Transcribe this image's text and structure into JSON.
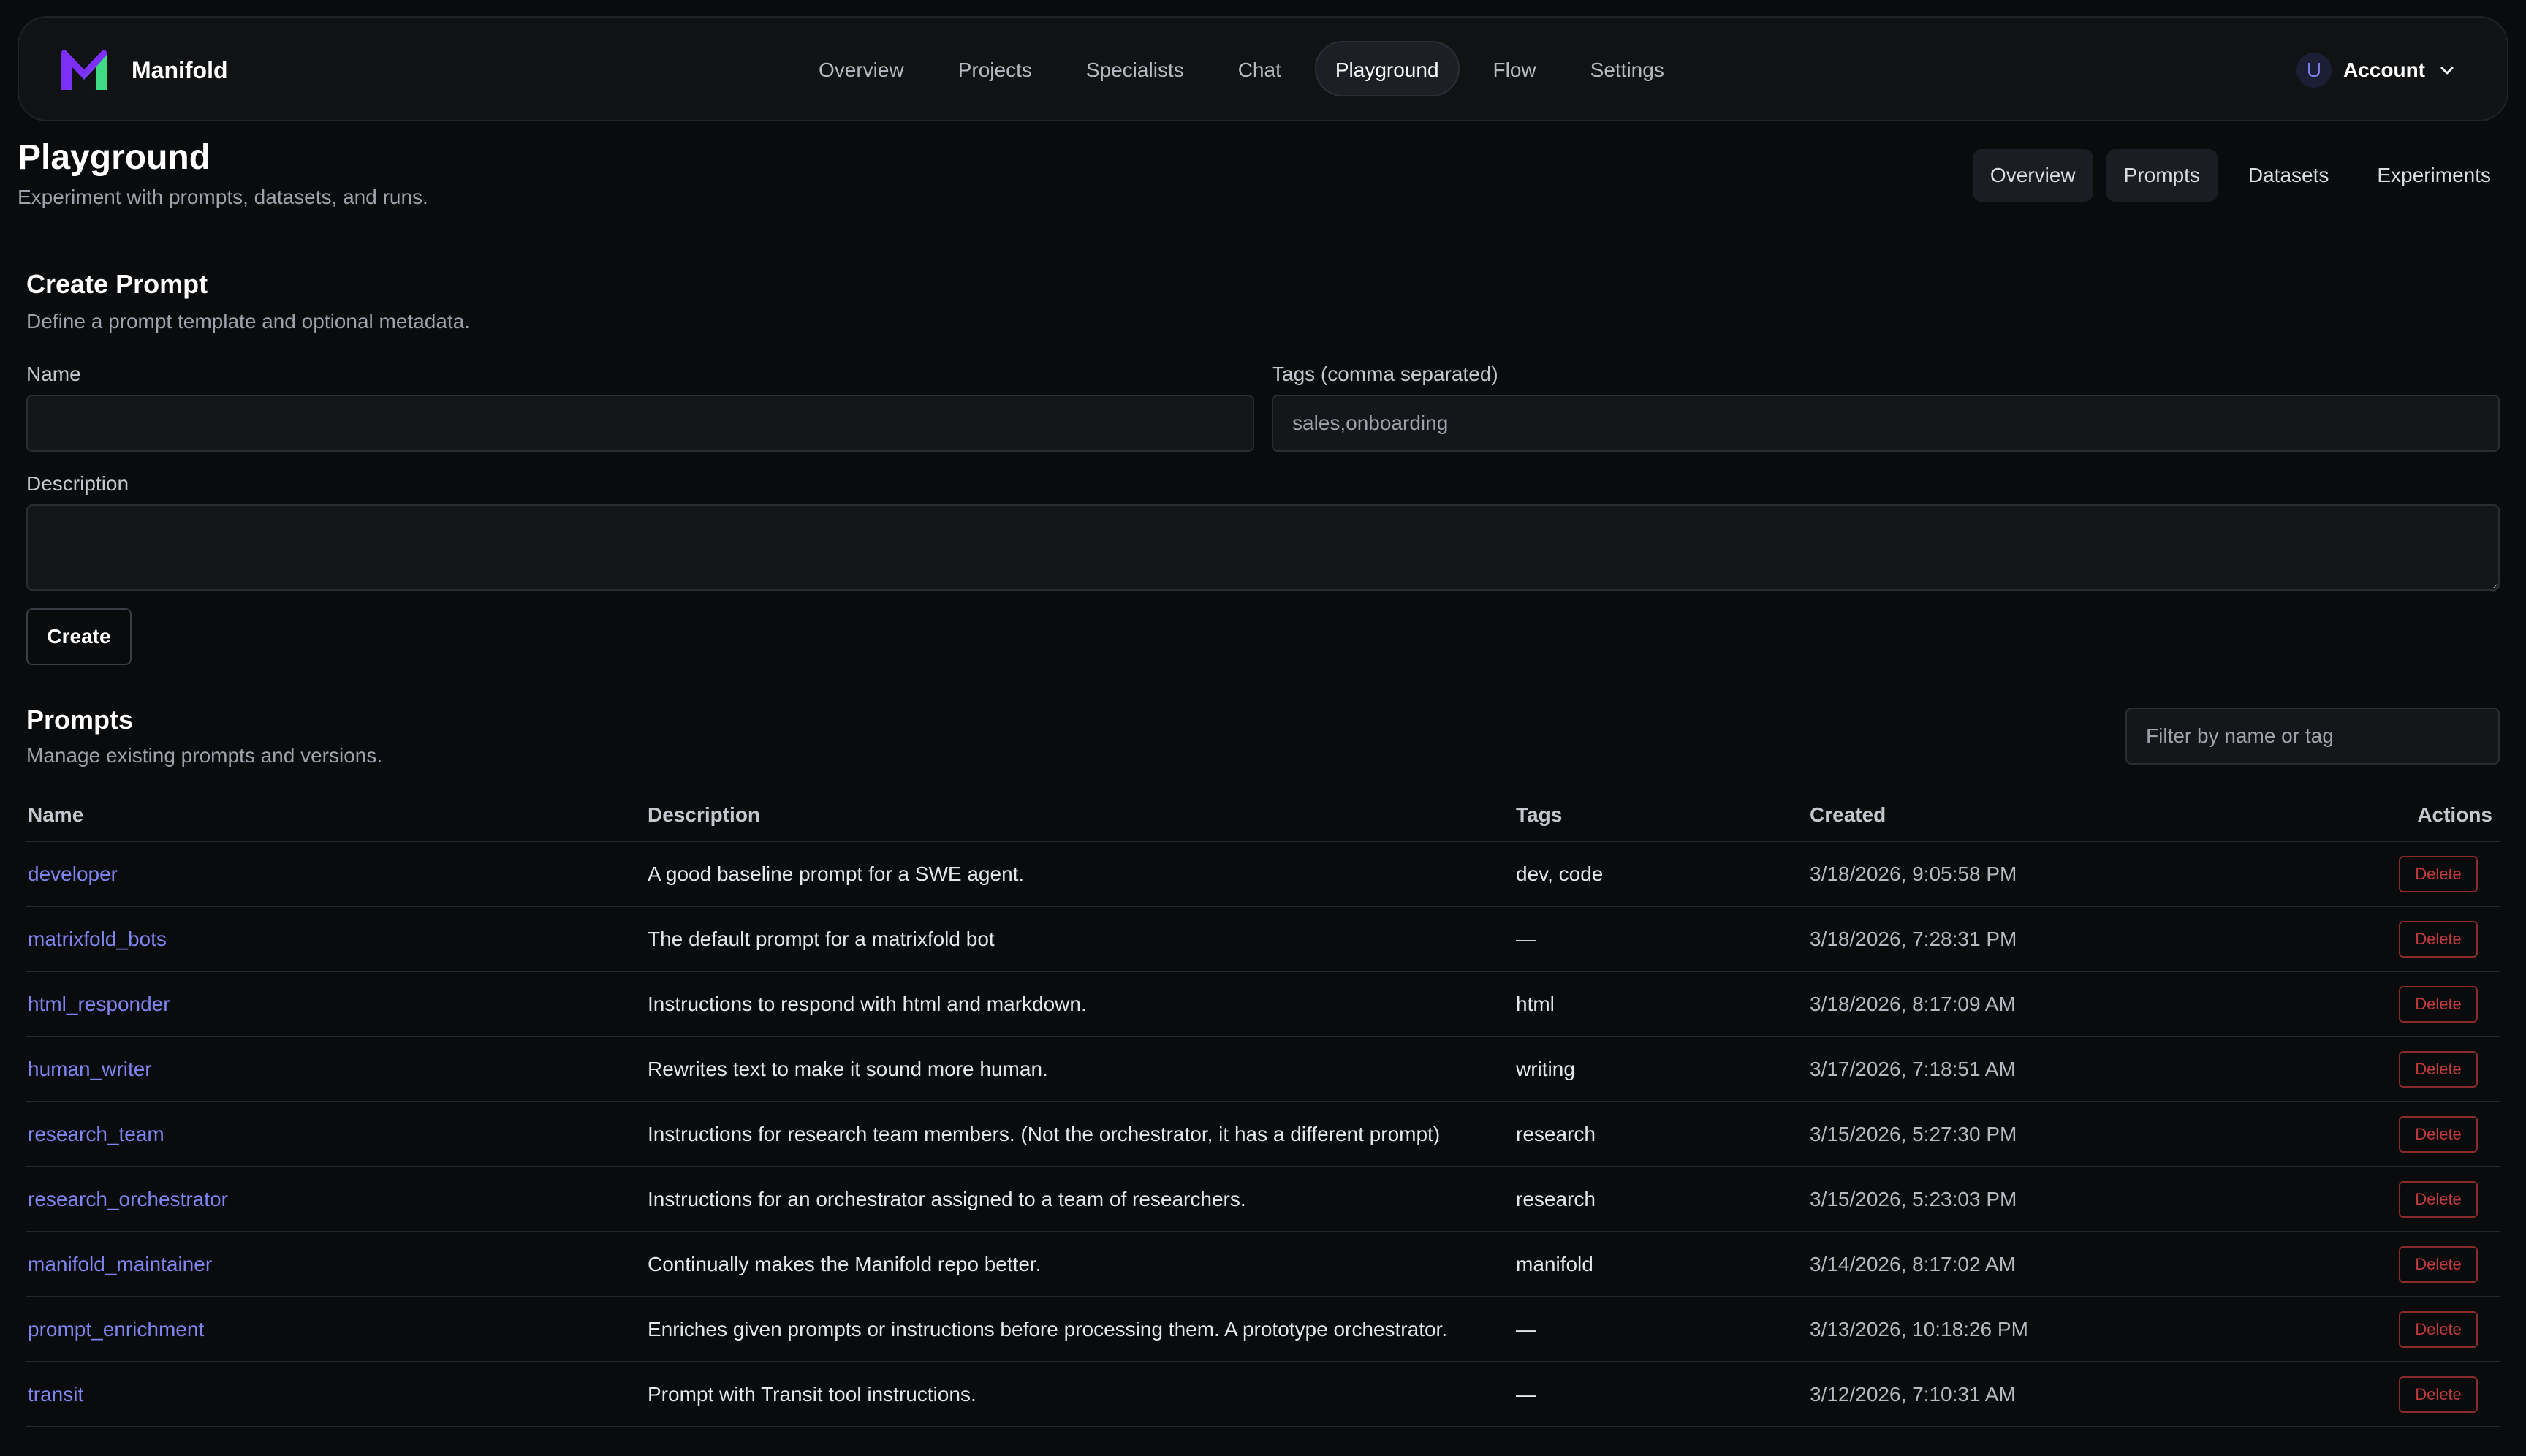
{
  "app": {
    "name": "Manifold"
  },
  "nav": {
    "items": [
      {
        "label": "Overview",
        "active": false
      },
      {
        "label": "Projects",
        "active": false
      },
      {
        "label": "Specialists",
        "active": false
      },
      {
        "label": "Chat",
        "active": false
      },
      {
        "label": "Playground",
        "active": true
      },
      {
        "label": "Flow",
        "active": false
      },
      {
        "label": "Settings",
        "active": false
      }
    ]
  },
  "account": {
    "avatar_initial": "U",
    "label": "Account"
  },
  "page": {
    "title": "Playground",
    "subtitle": "Experiment with prompts, datasets, and runs."
  },
  "subtabs": [
    {
      "label": "Overview",
      "active": false
    },
    {
      "label": "Prompts",
      "active": true
    },
    {
      "label": "Datasets",
      "active": false
    },
    {
      "label": "Experiments",
      "active": false
    }
  ],
  "create_prompt": {
    "title": "Create Prompt",
    "description": "Define a prompt template and optional metadata.",
    "name_label": "Name",
    "name_value": "",
    "tags_label": "Tags (comma separated)",
    "tags_placeholder": "sales,onboarding",
    "description_label": "Description",
    "description_value": "",
    "create_label": "Create"
  },
  "prompts": {
    "title": "Prompts",
    "description": "Manage existing prompts and versions.",
    "filter_placeholder": "Filter by name or tag",
    "columns": {
      "name": "Name",
      "description": "Description",
      "tags": "Tags",
      "created": "Created",
      "actions": "Actions"
    },
    "delete_label": "Delete",
    "rows": [
      {
        "name": "developer",
        "description": "A good baseline prompt for a SWE agent.",
        "tags": "dev, code",
        "created": "3/18/2026, 9:05:58 PM"
      },
      {
        "name": "matrixfold_bots",
        "description": "The default prompt for a matrixfold bot",
        "tags": "—",
        "created": "3/18/2026, 7:28:31 PM"
      },
      {
        "name": "html_responder",
        "description": "Instructions to respond with html and markdown.",
        "tags": "html",
        "created": "3/18/2026, 8:17:09 AM"
      },
      {
        "name": "human_writer",
        "description": "Rewrites text to make it sound more human.",
        "tags": "writing",
        "created": "3/17/2026, 7:18:51 AM"
      },
      {
        "name": "research_team",
        "description": "Instructions for research team members. (Not the orchestrator, it has a different prompt)",
        "tags": "research",
        "created": "3/15/2026, 5:27:30 PM"
      },
      {
        "name": "research_orchestrator",
        "description": "Instructions for an orchestrator assigned to a team of researchers.",
        "tags": "research",
        "created": "3/15/2026, 5:23:03 PM"
      },
      {
        "name": "manifold_maintainer",
        "description": "Continually makes the Manifold repo better.",
        "tags": "manifold",
        "created": "3/14/2026, 8:17:02 AM"
      },
      {
        "name": "prompt_enrichment",
        "description": "Enriches given prompts or instructions before processing them. A prototype orchestrator.",
        "tags": "—",
        "created": "3/13/2026, 10:18:26 PM"
      },
      {
        "name": "transit",
        "description": "Prompt with Transit tool instructions.",
        "tags": "—",
        "created": "3/12/2026, 7:10:31 AM"
      }
    ]
  },
  "colors": {
    "background": "#0a0b0d",
    "link": "#7f84f0",
    "danger": "#c0393b",
    "brand_green": "#3ddc84",
    "brand_purple": "#7b2ff7"
  },
  "icons": {
    "logo": "manifold-logo",
    "account_chevron": "chevron-down-icon"
  }
}
